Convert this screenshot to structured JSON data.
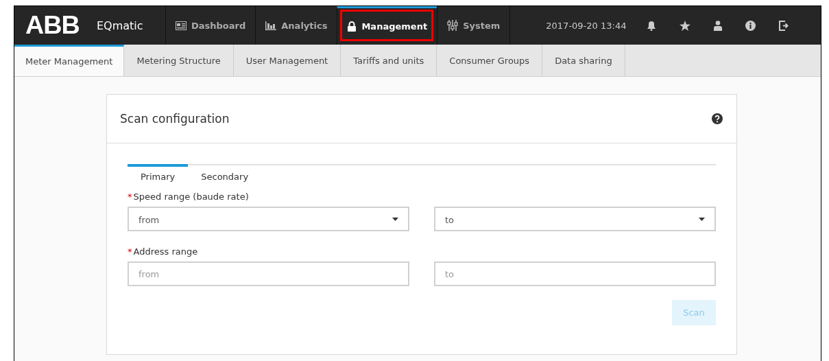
{
  "header": {
    "logo": "ABB",
    "app_name": "EQmatic",
    "nav": [
      {
        "label": "Dashboard",
        "selected": false,
        "highlighted": false
      },
      {
        "label": "Analytics",
        "selected": false,
        "highlighted": false
      },
      {
        "label": "Management",
        "selected": true,
        "highlighted": true
      },
      {
        "label": "System",
        "selected": false,
        "highlighted": false
      }
    ],
    "datetime": "2017-09-20 13:44"
  },
  "subtabs": [
    {
      "label": "Meter Management",
      "selected": true
    },
    {
      "label": "Metering Structure",
      "selected": false
    },
    {
      "label": "User Management",
      "selected": false
    },
    {
      "label": "Tariffs and units",
      "selected": false
    },
    {
      "label": "Consumer Groups",
      "selected": false
    },
    {
      "label": "Data sharing",
      "selected": false
    }
  ],
  "card": {
    "title": "Scan configuration",
    "tabs": [
      {
        "label": "Primary",
        "selected": true
      },
      {
        "label": "Secondary",
        "selected": false
      }
    ],
    "groups": [
      {
        "label": "Speed range (baude rate)",
        "required_mark": "*",
        "fields": [
          {
            "kind": "select",
            "placeholder": "from"
          },
          {
            "kind": "select",
            "placeholder": "to"
          }
        ]
      },
      {
        "label": "Address range",
        "required_mark": "*",
        "fields": [
          {
            "kind": "input",
            "placeholder": "from"
          },
          {
            "kind": "input",
            "placeholder": "to"
          }
        ]
      }
    ],
    "button": {
      "label": "Scan",
      "disabled": true
    }
  }
}
